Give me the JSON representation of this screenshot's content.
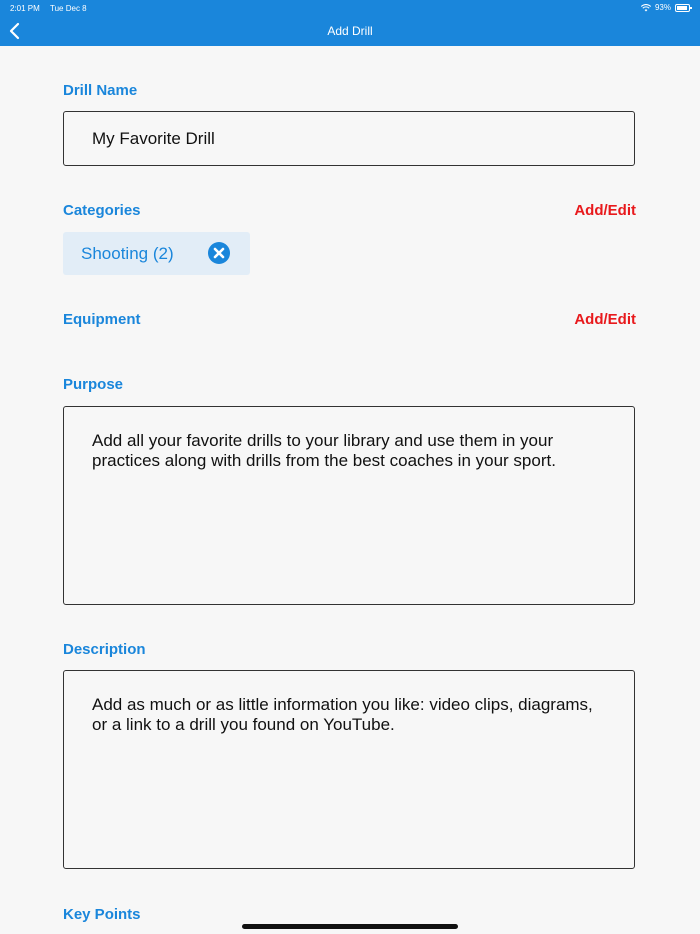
{
  "status_bar": {
    "time": "2:01 PM",
    "date": "Tue Dec 8",
    "battery": "93%",
    "battery_level": 0.93
  },
  "nav": {
    "title": "Add Drill",
    "back_icon": "chevron-left-icon"
  },
  "drill_name": {
    "label": "Drill Name",
    "value": "My Favorite Drill"
  },
  "categories": {
    "label": "Categories",
    "action": "Add/Edit",
    "chips": [
      {
        "label": "Shooting (2)",
        "remove_icon": "close-circle-icon"
      }
    ]
  },
  "equipment": {
    "label": "Equipment",
    "action": "Add/Edit"
  },
  "purpose": {
    "label": "Purpose",
    "value": "Add all your favorite drills to your library and use them in your practices along with drills from the best coaches in your sport."
  },
  "description": {
    "label": "Description",
    "value": "Add as much or as little information you like: video clips, diagrams, or a link to a drill you found on YouTube."
  },
  "key_points": {
    "label": "Key Points"
  },
  "colors": {
    "accent": "#1a86db",
    "action_red": "#e8191c",
    "chip_bg": "#e2edf7",
    "background": "#f7f7f7"
  }
}
